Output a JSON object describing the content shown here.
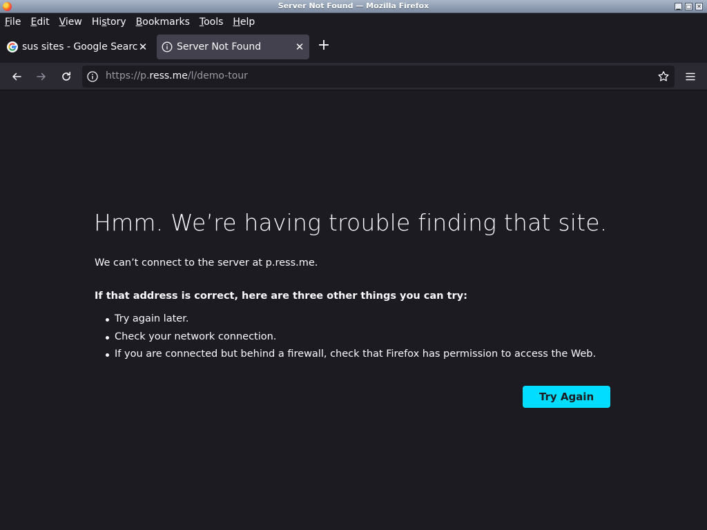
{
  "window": {
    "title": "Server Not Found — Mozilla Firefox"
  },
  "menubar": {
    "items": [
      {
        "mnemonic": "F",
        "rest": "ile"
      },
      {
        "mnemonic": "E",
        "rest": "dit"
      },
      {
        "mnemonic": "V",
        "rest": "iew"
      },
      {
        "pre": "Hi",
        "mnemonic": "s",
        "rest": "tory"
      },
      {
        "mnemonic": "B",
        "rest": "ookmarks"
      },
      {
        "mnemonic": "T",
        "rest": "ools"
      },
      {
        "mnemonic": "H",
        "rest": "elp"
      }
    ]
  },
  "tabs": [
    {
      "label": "sus sites - Google Search",
      "icon": "google-icon",
      "active": false
    },
    {
      "label": "Server Not Found",
      "icon": "info-icon",
      "active": true
    }
  ],
  "urlbar": {
    "prefix": "https://p.",
    "host": "ress.me",
    "suffix": "/l/demo-tour"
  },
  "error": {
    "title": "Hmm. We’re having trouble finding that site.",
    "short_desc": "We can’t connect to the server at p.ress.me.",
    "suggestions_heading": "If that address is correct, here are three other things you can try:",
    "suggestions": [
      "Try again later.",
      "Check your network connection.",
      "If you are connected but behind a firewall, check that Firefox has permission to access the Web."
    ],
    "button_label": "Try Again"
  },
  "colors": {
    "page_bg": "#1c1b22",
    "toolbar_bg": "#2b2a33",
    "active_tab_bg": "#42414d",
    "button_accent": "#00ddff"
  }
}
